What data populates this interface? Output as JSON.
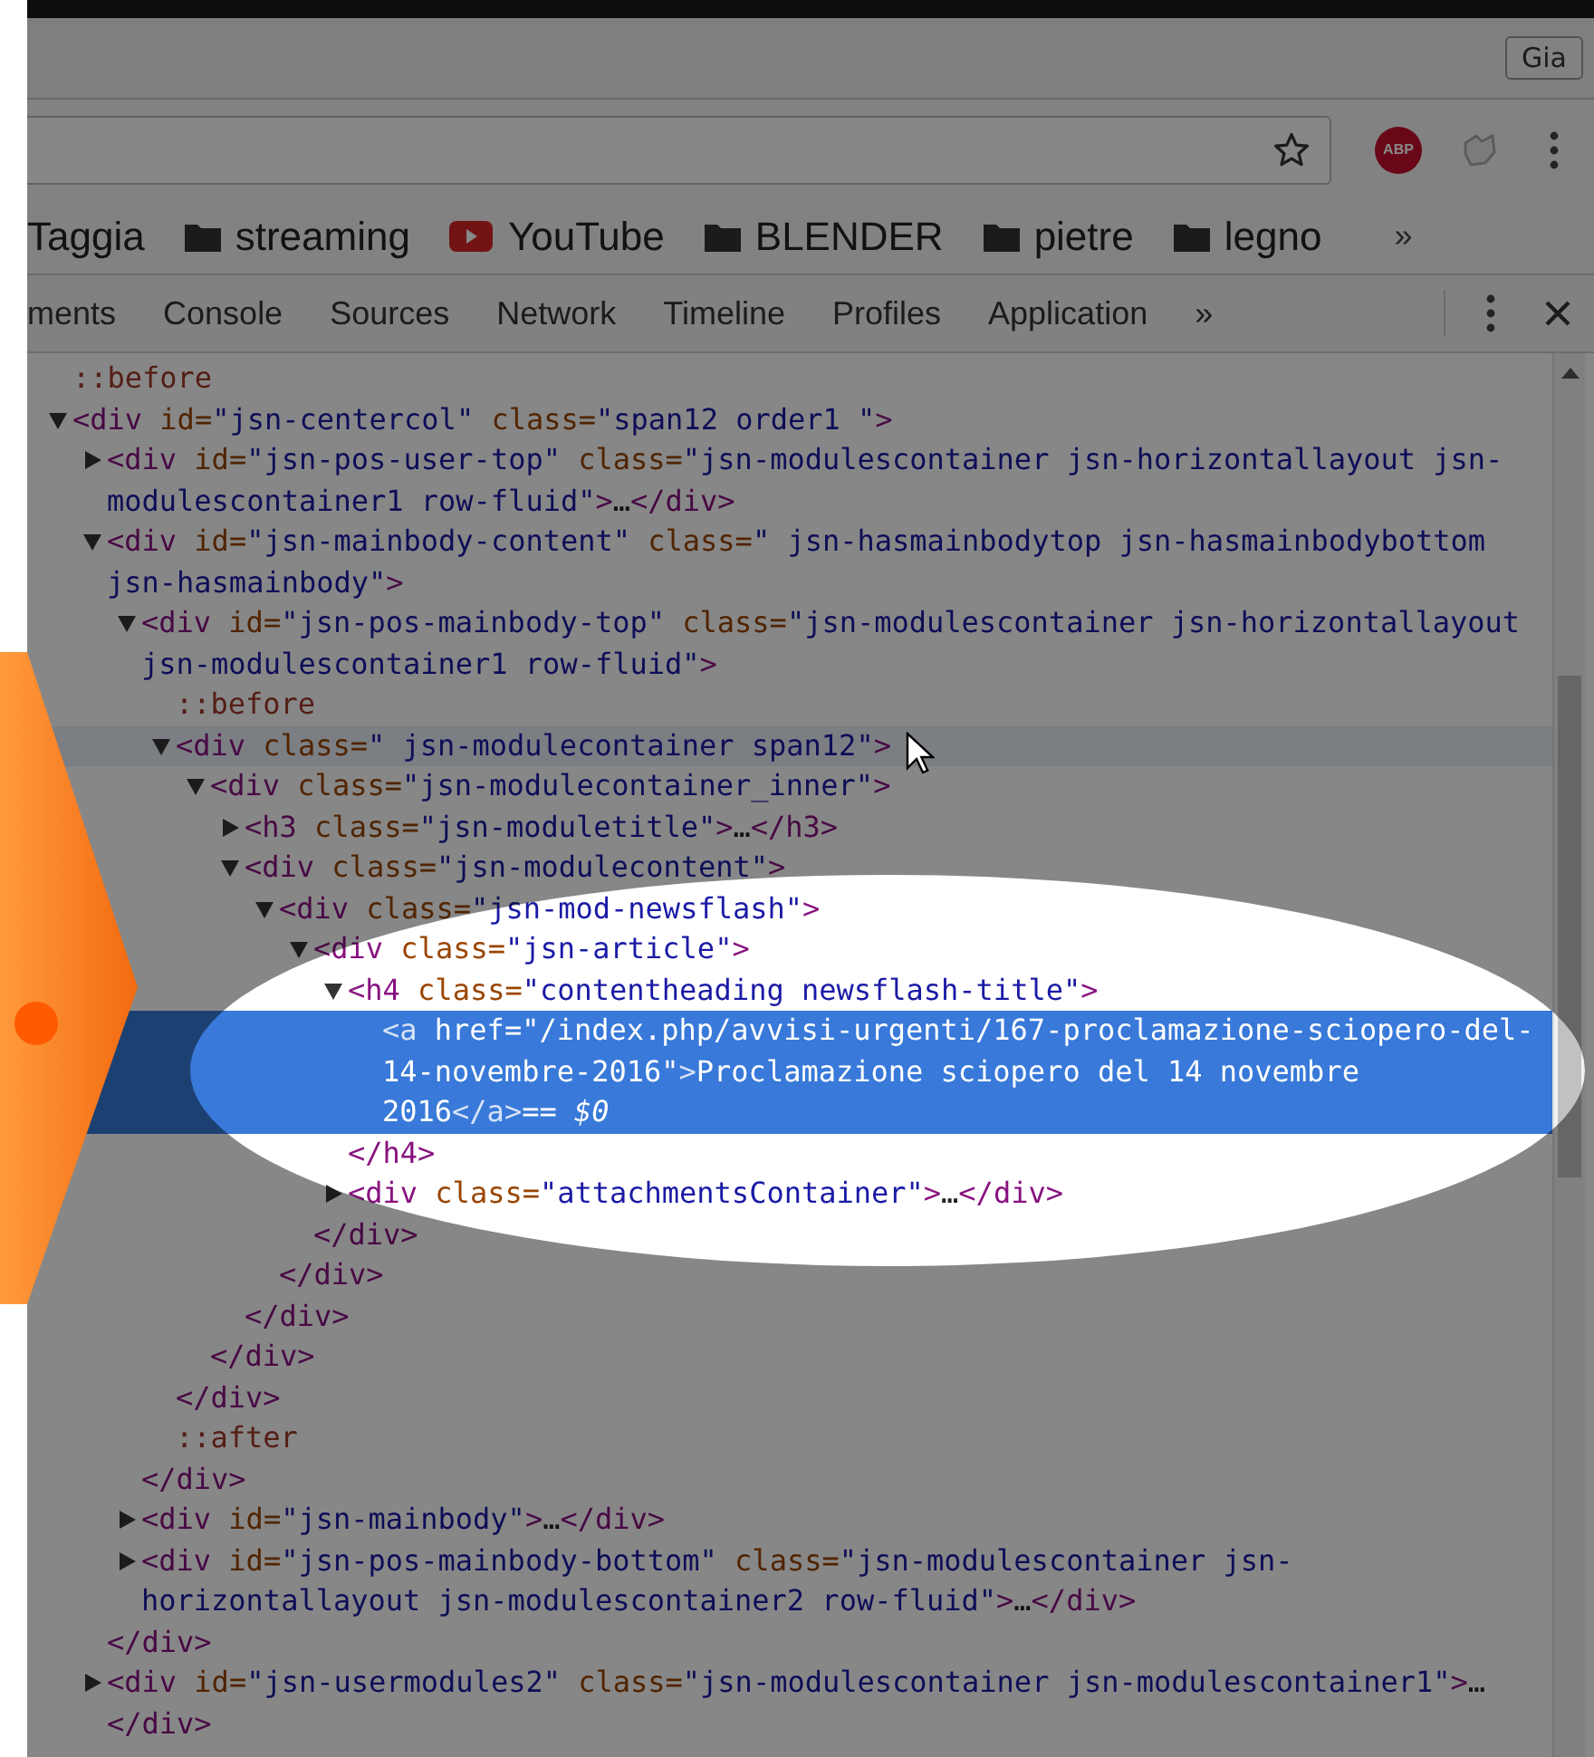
{
  "browser": {
    "profile_button": "Gia",
    "toolbar": {
      "extension_badge": "ABP"
    },
    "bookmarks": [
      {
        "kind": "plain",
        "label": "Taggia"
      },
      {
        "kind": "folder",
        "label": "streaming"
      },
      {
        "kind": "video",
        "label": "YouTube"
      },
      {
        "kind": "folder",
        "label": "BLENDER"
      },
      {
        "kind": "folder",
        "label": "pietre"
      },
      {
        "kind": "folder",
        "label": "legno"
      }
    ],
    "bookmarks_overflow": "»"
  },
  "devtools": {
    "tabs": [
      {
        "label": "ments"
      },
      {
        "label": "Console"
      },
      {
        "label": "Sources"
      },
      {
        "label": "Network"
      },
      {
        "label": "Timeline"
      },
      {
        "label": "Profiles"
      },
      {
        "label": "Application"
      }
    ],
    "tabs_overflow": "»",
    "tree": [
      {
        "kind": "pseudo",
        "open": "::before",
        "selected": false,
        "hovered": false
      },
      {
        "kind": "element",
        "open": "<div id=\"jsn-centercol\" class=\"span12 order1 \">",
        "expanded": true,
        "selected": false,
        "hovered": false,
        "children": [
          {
            "kind": "element",
            "open": "<div id=\"jsn-pos-user-top\" class=\"jsn-modulescontainer jsn-horizontallayout jsn-modulescontainer1 row-fluid\">…</div>",
            "expanded": false,
            "selected": false,
            "hovered": false
          },
          {
            "kind": "element",
            "open": "<div id=\"jsn-mainbody-content\" class=\" jsn-hasmainbodytop jsn-hasmainbodybottom jsn-hasmainbody\">",
            "expanded": true,
            "selected": false,
            "hovered": false,
            "close": "</div>",
            "children": [
              {
                "kind": "element",
                "open": "<div id=\"jsn-pos-mainbody-top\" class=\"jsn-modulescontainer jsn-horizontallayout jsn-modulescontainer1 row-fluid\">",
                "expanded": true,
                "selected": false,
                "hovered": false,
                "close": "</div>",
                "children": [
                  {
                    "kind": "pseudo",
                    "open": "::before",
                    "selected": false,
                    "hovered": false
                  },
                  {
                    "kind": "element",
                    "open": "<div class=\" jsn-modulecontainer span12\">",
                    "expanded": true,
                    "selected": false,
                    "hovered": true,
                    "close": "</div>",
                    "children": [
                      {
                        "kind": "element",
                        "open": "<div class=\"jsn-modulecontainer_inner\">",
                        "expanded": true,
                        "selected": false,
                        "hovered": false,
                        "close": "</div>",
                        "children": [
                          {
                            "kind": "element",
                            "open": "<h3 class=\"jsn-moduletitle\">…</h3>",
                            "expanded": false,
                            "selected": false,
                            "hovered": false
                          },
                          {
                            "kind": "element",
                            "open": "<div class=\"jsn-modulecontent\">",
                            "expanded": true,
                            "selected": false,
                            "hovered": false,
                            "close": "</div>",
                            "children": [
                              {
                                "kind": "element",
                                "open": "<div class=\"jsn-mod-newsflash\">",
                                "expanded": true,
                                "selected": false,
                                "hovered": false,
                                "close": "</div>",
                                "children": [
                                  {
                                    "kind": "element",
                                    "open": "<div class=\"jsn-article\">",
                                    "expanded": true,
                                    "selected": false,
                                    "hovered": false,
                                    "close": "</div>",
                                    "children": [
                                      {
                                        "kind": "element",
                                        "open": "<h4 class=\"contentheading newsflash-title\">",
                                        "expanded": true,
                                        "selected": false,
                                        "hovered": false,
                                        "close": "</h4>",
                                        "children": [
                                          {
                                            "kind": "leaf",
                                            "open": "<a href=\"/index.php/avvisi-urgenti/167-proclamazione-sciopero-del-14-novembre-2016\">Proclamazione sciopero del 14 novembre 2016</a>",
                                            "suffix": "== *$0*",
                                            "selected": true
                                          }
                                        ]
                                      },
                                      {
                                        "kind": "element",
                                        "open": "<div class=\"attachmentsContainer\">…</div>",
                                        "expanded": false,
                                        "selected": false,
                                        "hovered": false
                                      }
                                    ]
                                  }
                                ]
                              }
                            ]
                          }
                        ]
                      }
                    ]
                  },
                  {
                    "kind": "pseudo",
                    "open": "::after",
                    "selected": false,
                    "hovered": false
                  }
                ]
              },
              {
                "kind": "element",
                "open": "<div id=\"jsn-mainbody\">…</div>",
                "expanded": false,
                "selected": false,
                "hovered": false
              },
              {
                "kind": "element",
                "open": "<div id=\"jsn-pos-mainbody-bottom\" class=\"jsn-modulescontainer jsn-horizontallayout jsn-modulescontainer2 row-fluid\">…</div>",
                "expanded": false,
                "selected": false,
                "hovered": false
              }
            ]
          },
          {
            "kind": "element",
            "open": "<div id=\"jsn-usermodules2\" class=\"jsn-modulescontainer jsn-modulescontainer1\">…</div>",
            "expanded": false,
            "selected": false,
            "hovered": false
          }
        ]
      }
    ]
  }
}
